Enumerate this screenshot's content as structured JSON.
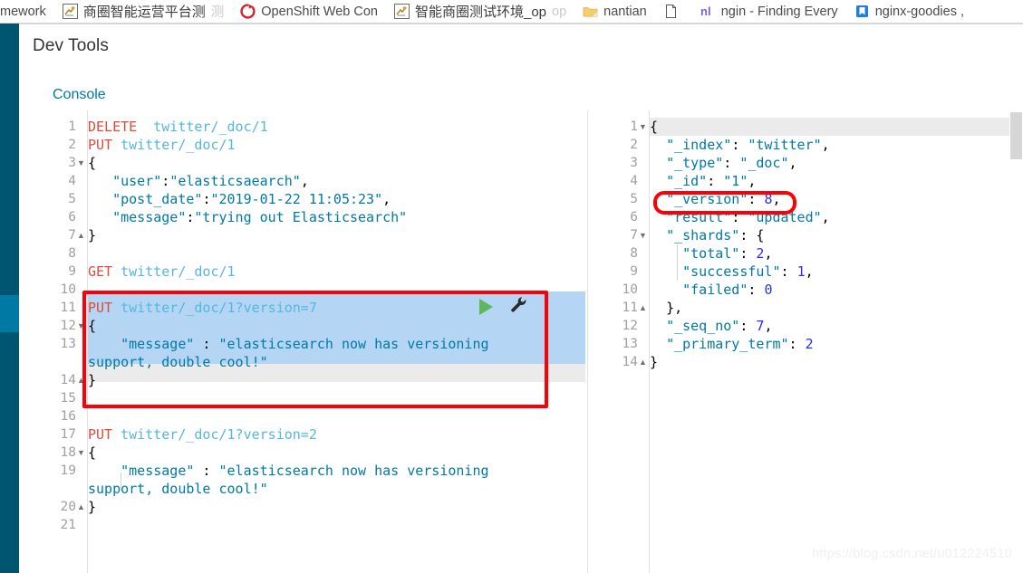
{
  "browser": {
    "bookmarks": [
      {
        "label": "mework",
        "icon": "none",
        "truncated": false
      },
      {
        "label": "商圈智能运营平台测",
        "icon": "favicon-runner-icon",
        "truncated": true
      },
      {
        "label": "OpenShift Web Con",
        "icon": "openshift-logo-icon",
        "truncated": true
      },
      {
        "label": "智能商圈测试环境_op",
        "icon": "favicon-runner-icon",
        "truncated": true
      },
      {
        "label": "nantian",
        "icon": "folder-icon",
        "truncated": false
      },
      {
        "label": "",
        "icon": "page-icon",
        "truncated": false
      },
      {
        "label": "ngin - Finding Every",
        "icon": "nl-logo-icon",
        "truncated": true
      },
      {
        "label": "nginx-goodies ,",
        "icon": "blue-bookmark-icon",
        "truncated": true
      }
    ]
  },
  "app": {
    "title": "Dev Tools",
    "tabs": [
      {
        "label": "Console",
        "active": true
      }
    ],
    "accent_color": "#0079a5",
    "rail_color": "#005571",
    "rail_active_color": "#0079a5"
  },
  "editor": {
    "name": "console-request-editor",
    "line_numbers": [
      "1",
      "2",
      "3",
      "4",
      "5",
      "6",
      "7",
      "8",
      "9",
      "10",
      "11",
      "12",
      "13",
      "14",
      "15",
      "16",
      "17",
      "18",
      "19",
      "20",
      "21"
    ],
    "fold_markers": {
      "3": "down",
      "7": "up",
      "12": "down",
      "14": "up",
      "18": "down",
      "20": "up"
    },
    "lines": [
      {
        "n": 1,
        "tokens": [
          {
            "t": "DELETE",
            "c": "m"
          },
          {
            "t": "  ",
            "c": "p"
          },
          {
            "t": "twitter/_doc/1",
            "c": "url"
          }
        ]
      },
      {
        "n": 2,
        "tokens": [
          {
            "t": "PUT",
            "c": "m"
          },
          {
            "t": " ",
            "c": "p"
          },
          {
            "t": "twitter/_doc/1",
            "c": "url"
          }
        ]
      },
      {
        "n": 3,
        "tokens": [
          {
            "t": "{",
            "c": "p"
          }
        ]
      },
      {
        "n": 4,
        "tokens": [
          {
            "t": "   ",
            "c": "p"
          },
          {
            "t": "\"user\"",
            "c": "k"
          },
          {
            "t": ":",
            "c": "p"
          },
          {
            "t": "\"elasticsaearch\"",
            "c": "s"
          },
          {
            "t": ",",
            "c": "p"
          }
        ]
      },
      {
        "n": 5,
        "tokens": [
          {
            "t": "   ",
            "c": "p"
          },
          {
            "t": "\"post_date\"",
            "c": "k"
          },
          {
            "t": ":",
            "c": "p"
          },
          {
            "t": "\"2019-01-22 11:05:23\"",
            "c": "s"
          },
          {
            "t": ",",
            "c": "p"
          }
        ]
      },
      {
        "n": 6,
        "tokens": [
          {
            "t": "   ",
            "c": "p"
          },
          {
            "t": "\"message\"",
            "c": "k"
          },
          {
            "t": ":",
            "c": "p"
          },
          {
            "t": "\"trying out Elasticsearch\"",
            "c": "s"
          }
        ]
      },
      {
        "n": 7,
        "tokens": [
          {
            "t": "}",
            "c": "p"
          }
        ]
      },
      {
        "n": 8,
        "tokens": []
      },
      {
        "n": 9,
        "tokens": [
          {
            "t": "GET",
            "c": "m"
          },
          {
            "t": " ",
            "c": "p"
          },
          {
            "t": "twitter/_doc/1",
            "c": "url"
          }
        ]
      },
      {
        "n": 10,
        "tokens": []
      },
      {
        "n": 11,
        "tokens": [
          {
            "t": "PUT",
            "c": "m"
          },
          {
            "t": " ",
            "c": "p"
          },
          {
            "t": "twitter/_doc/1?version=7",
            "c": "url"
          }
        ]
      },
      {
        "n": 12,
        "tokens": [
          {
            "t": "{",
            "c": "p"
          }
        ]
      },
      {
        "n": 13,
        "tokens": [
          {
            "t": "    ",
            "c": "p"
          },
          {
            "t": "\"message\"",
            "c": "k"
          },
          {
            "t": " : ",
            "c": "p"
          },
          {
            "t": "\"elasticsearch now has versioning",
            "c": "s"
          }
        ]
      },
      {
        "n": 13.5,
        "wrap": true,
        "tokens": [
          {
            "t": "support, double cool!\"",
            "c": "s"
          }
        ]
      },
      {
        "n": 14,
        "tokens": [
          {
            "t": "}",
            "c": "p"
          }
        ]
      },
      {
        "n": 15,
        "tokens": []
      },
      {
        "n": 16,
        "tokens": []
      },
      {
        "n": 17,
        "tokens": [
          {
            "t": "PUT",
            "c": "m"
          },
          {
            "t": " ",
            "c": "p"
          },
          {
            "t": "twitter/_doc/1?version=2",
            "c": "url"
          }
        ]
      },
      {
        "n": 18,
        "tokens": [
          {
            "t": "{",
            "c": "p"
          }
        ]
      },
      {
        "n": 19,
        "tokens": [
          {
            "t": "    ",
            "c": "p"
          },
          {
            "t": "\"message\"",
            "c": "k"
          },
          {
            "t": " : ",
            "c": "p"
          },
          {
            "t": "\"elasticsearch now has versioning",
            "c": "s"
          }
        ]
      },
      {
        "n": 19.5,
        "wrap": true,
        "tokens": [
          {
            "t": "support, double cool!\"",
            "c": "s"
          }
        ]
      },
      {
        "n": 20,
        "tokens": [
          {
            "t": "}",
            "c": "p"
          }
        ]
      },
      {
        "n": 21,
        "tokens": []
      }
    ],
    "selected_request": "PUT twitter/_doc/1?version=7",
    "actions": {
      "play": "send-request",
      "wrench": "request-options"
    }
  },
  "response": {
    "name": "console-response-viewer",
    "line_numbers": [
      "1",
      "2",
      "3",
      "4",
      "5",
      "6",
      "7",
      "8",
      "9",
      "10",
      "11",
      "12",
      "13",
      "14"
    ],
    "lines": [
      {
        "n": 1,
        "tokens": [
          {
            "t": "{",
            "c": "p"
          }
        ]
      },
      {
        "n": 2,
        "tokens": [
          {
            "t": "  ",
            "c": "p"
          },
          {
            "t": "\"_index\"",
            "c": "kr"
          },
          {
            "t": ": ",
            "c": "p"
          },
          {
            "t": "\"twitter\"",
            "c": "s"
          },
          {
            "t": ",",
            "c": "p"
          }
        ]
      },
      {
        "n": 3,
        "tokens": [
          {
            "t": "  ",
            "c": "p"
          },
          {
            "t": "\"_type\"",
            "c": "kr"
          },
          {
            "t": ": ",
            "c": "p"
          },
          {
            "t": "\"_doc\"",
            "c": "s"
          },
          {
            "t": ",",
            "c": "p"
          }
        ]
      },
      {
        "n": 4,
        "tokens": [
          {
            "t": "  ",
            "c": "p"
          },
          {
            "t": "\"_id\"",
            "c": "kr"
          },
          {
            "t": ": ",
            "c": "p"
          },
          {
            "t": "\"1\"",
            "c": "s"
          },
          {
            "t": ",",
            "c": "p"
          }
        ]
      },
      {
        "n": 5,
        "tokens": [
          {
            "t": "  ",
            "c": "p"
          },
          {
            "t": "\"_version\"",
            "c": "kr"
          },
          {
            "t": ": ",
            "c": "p"
          },
          {
            "t": "8",
            "c": "num"
          },
          {
            "t": ",",
            "c": "p"
          }
        ]
      },
      {
        "n": 6,
        "tokens": [
          {
            "t": "  ",
            "c": "p"
          },
          {
            "t": "\"result\"",
            "c": "kr"
          },
          {
            "t": ": ",
            "c": "p"
          },
          {
            "t": "\"updated\"",
            "c": "s"
          },
          {
            "t": ",",
            "c": "p"
          }
        ]
      },
      {
        "n": 7,
        "tokens": [
          {
            "t": "  ",
            "c": "p"
          },
          {
            "t": "\"_shards\"",
            "c": "kr"
          },
          {
            "t": ": ",
            "c": "p"
          },
          {
            "t": "{",
            "c": "p"
          }
        ]
      },
      {
        "n": 8,
        "tokens": [
          {
            "t": "    ",
            "c": "p"
          },
          {
            "t": "\"total\"",
            "c": "kr"
          },
          {
            "t": ": ",
            "c": "p"
          },
          {
            "t": "2",
            "c": "num"
          },
          {
            "t": ",",
            "c": "p"
          }
        ]
      },
      {
        "n": 9,
        "tokens": [
          {
            "t": "    ",
            "c": "p"
          },
          {
            "t": "\"successful\"",
            "c": "kr"
          },
          {
            "t": ": ",
            "c": "p"
          },
          {
            "t": "1",
            "c": "num"
          },
          {
            "t": ",",
            "c": "p"
          }
        ]
      },
      {
        "n": 10,
        "tokens": [
          {
            "t": "    ",
            "c": "p"
          },
          {
            "t": "\"failed\"",
            "c": "kr"
          },
          {
            "t": ": ",
            "c": "p"
          },
          {
            "t": "0",
            "c": "num"
          }
        ]
      },
      {
        "n": 11,
        "tokens": [
          {
            "t": "  ",
            "c": "p"
          },
          {
            "t": "},",
            "c": "p"
          }
        ]
      },
      {
        "n": 12,
        "tokens": [
          {
            "t": "  ",
            "c": "p"
          },
          {
            "t": "\"_seq_no\"",
            "c": "kr"
          },
          {
            "t": ": ",
            "c": "p"
          },
          {
            "t": "7",
            "c": "num"
          },
          {
            "t": ",",
            "c": "p"
          }
        ]
      },
      {
        "n": 13,
        "tokens": [
          {
            "t": "  ",
            "c": "p"
          },
          {
            "t": "\"_primary_term\"",
            "c": "kr"
          },
          {
            "t": ": ",
            "c": "p"
          },
          {
            "t": "2",
            "c": "num"
          }
        ]
      },
      {
        "n": 14,
        "tokens": [
          {
            "t": "}",
            "c": "p"
          }
        ]
      }
    ],
    "fold_markers": {
      "1": "down",
      "7": "down",
      "11": "up",
      "14": "up"
    },
    "highlighted_field": "\"_version\": 8,"
  },
  "annotations": {
    "highlight_color": "#fb0007",
    "boxes": [
      {
        "name": "request-highlight-box",
        "target": "PUT twitter/_doc/1?version=7 block"
      },
      {
        "name": "version-highlight-box",
        "target": "\"_version\": 8,"
      }
    ]
  },
  "watermark": {
    "text": "https://blog.csdn.net/u012224510"
  }
}
